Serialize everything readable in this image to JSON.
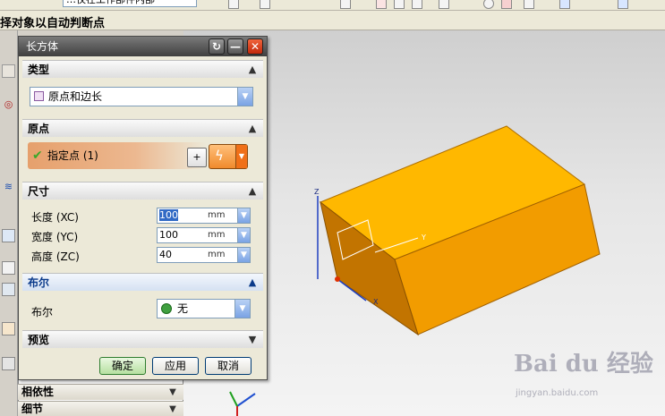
{
  "topbar": {
    "field_text": "…仅在工作部件内部",
    "status": "择对象以自动判断点"
  },
  "dialog": {
    "title": "长方体",
    "type_section": {
      "label": "类型",
      "selected": "原点和边长"
    },
    "origin_section": {
      "label": "原点",
      "point_label": "指定点 (1)"
    },
    "dimension_section": {
      "label": "尺寸",
      "rows": [
        {
          "label": "长度 (XC)",
          "value": "100",
          "unit": "mm"
        },
        {
          "label": "宽度 (YC)",
          "value": "100",
          "unit": "mm"
        },
        {
          "label": "高度 (ZC)",
          "value": "40",
          "unit": "mm"
        }
      ]
    },
    "boolean_section": {
      "label": "布尔",
      "field_label": "布尔",
      "selected": "无"
    },
    "preview_section": {
      "label": "预览"
    },
    "buttons": {
      "ok": "确定",
      "apply": "应用",
      "cancel": "取消"
    }
  },
  "navigator": {
    "rows": [
      "相依性",
      "细节"
    ]
  },
  "viewport": {
    "axis_x": "X",
    "axis_y": "Y",
    "axis_z": "Z"
  },
  "watermark": {
    "brand": "Bai du 经验",
    "url": "jingyan.baidu.com"
  },
  "colors": {
    "box_top": "#ffb800",
    "box_front": "#f09a00",
    "box_side": "#c87800",
    "titlebar": "#505050",
    "active_section": "#0a3a8a",
    "check": "#3aa82a"
  }
}
